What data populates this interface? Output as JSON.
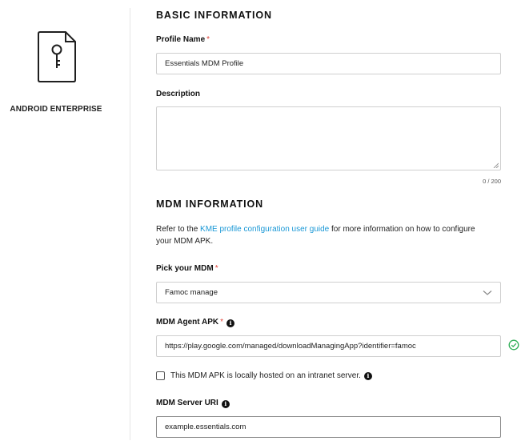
{
  "sidebar": {
    "device_label": "ANDROID ENTERPRISE",
    "device_icon": "key-document-icon"
  },
  "basic_info": {
    "title": "BASIC INFORMATION",
    "profile_name_label": "Profile Name",
    "profile_name_value": "Essentials MDM Profile",
    "description_label": "Description",
    "description_value": "",
    "description_counter": "0 / 200"
  },
  "mdm_info": {
    "title": "MDM INFORMATION",
    "help_prefix": "Refer to the ",
    "help_link": "KME profile configuration user guide",
    "help_suffix": " for more information on how to configure your MDM APK.",
    "pick_mdm_label": "Pick your MDM",
    "pick_mdm_value": "Famoc manage",
    "agent_apk_label": "MDM Agent APK",
    "agent_apk_value": "https://play.google.com/managed/downloadManagingApp?identifier=famoc",
    "agent_apk_status": "valid",
    "intranet_checkbox_label": "This MDM APK is locally hosted on an intranet server.",
    "intranet_checked": false,
    "server_uri_label": "MDM Server URI",
    "server_uri_value": "example.essentials.com"
  },
  "common": {
    "required_mark": "*",
    "info_glyph": "i"
  },
  "colors": {
    "link": "#1a98d6",
    "required": "#e0453a",
    "valid": "#2fae57"
  }
}
